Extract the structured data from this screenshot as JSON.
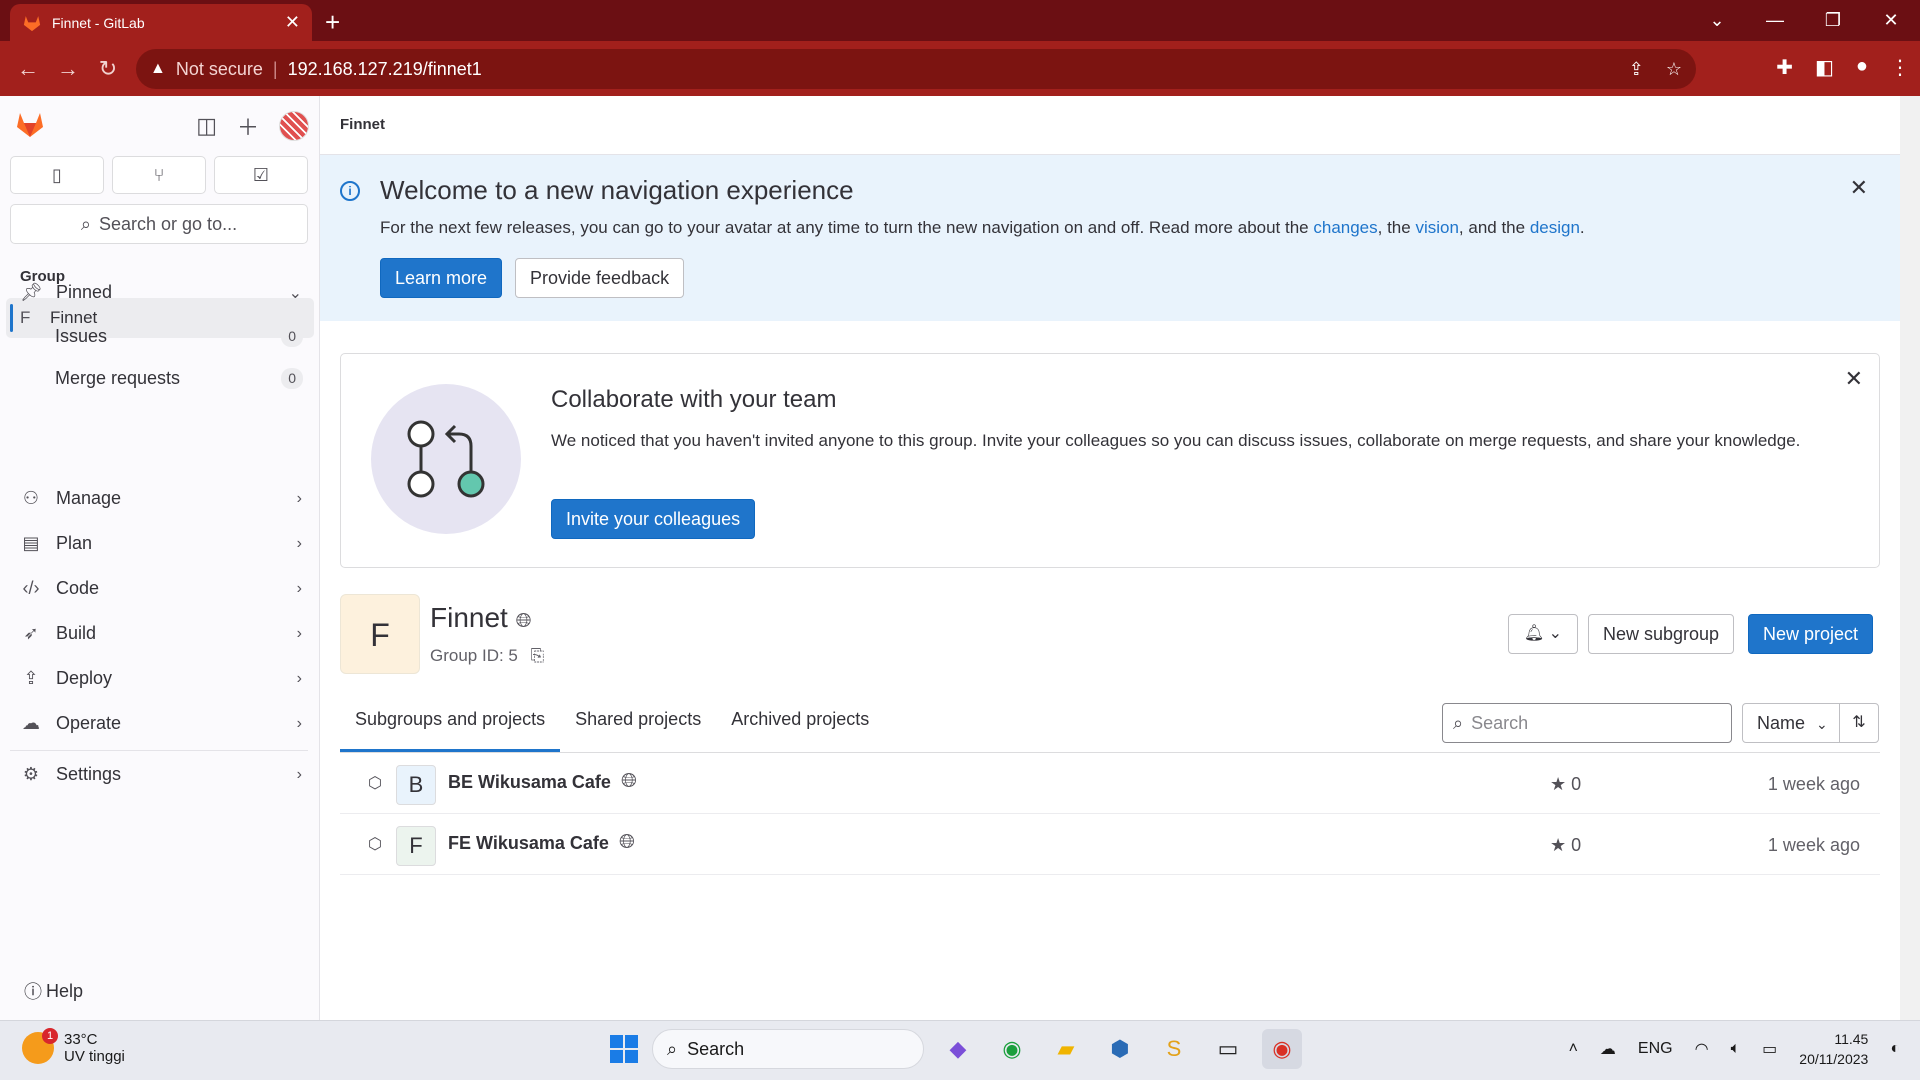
{
  "browser": {
    "tab_title": "Finnet - GitLab",
    "new_tab": "+",
    "security_label": "Not secure",
    "url": "192.168.127.219/finnet1"
  },
  "sidebar": {
    "search_placeholder": "Search or go to...",
    "context_label": "Group",
    "group": {
      "letter": "F",
      "name": "Finnet"
    },
    "pinned_label": "Pinned",
    "pinned_items": [
      {
        "label": "Issues",
        "count": "0"
      },
      {
        "label": "Merge requests",
        "count": "0"
      }
    ],
    "menu": [
      {
        "label": "Manage",
        "icon": "users-icon"
      },
      {
        "label": "Plan",
        "icon": "calendar-icon"
      },
      {
        "label": "Code",
        "icon": "code-icon"
      },
      {
        "label": "Build",
        "icon": "rocket-icon"
      },
      {
        "label": "Deploy",
        "icon": "deploy-icon"
      },
      {
        "label": "Operate",
        "icon": "cloud-icon"
      }
    ],
    "settings_label": "Settings",
    "help_label": "Help"
  },
  "breadcrumb": "Finnet",
  "welcome": {
    "title": "Welcome to a new navigation experience",
    "text_pre": "For the next few releases, you can go to your avatar at any time to turn the new navigation on and off. Read more about the ",
    "link_changes": "changes",
    "sep1": ", the ",
    "link_vision": "vision",
    "sep2": ", and the ",
    "link_design": "design",
    "end": ".",
    "learn_more": "Learn more",
    "feedback": "Provide feedback"
  },
  "collab": {
    "title": "Collaborate with your team",
    "text": "We noticed that you haven't invited anyone to this group. Invite your colleagues so you can discuss issues, collaborate on merge requests, and share your knowledge.",
    "invite": "Invite your colleagues"
  },
  "group": {
    "avatar_letter": "F",
    "name": "Finnet",
    "id_text": "Group ID: 5",
    "new_subgroup": "New subgroup",
    "new_project": "New project"
  },
  "tabs": [
    "Subgroups and projects",
    "Shared projects",
    "Archived projects"
  ],
  "list": {
    "search_placeholder": "Search",
    "sort_label": "Name"
  },
  "projects": [
    {
      "letter": "B",
      "name": "BE Wikusama Cafe",
      "stars": "0",
      "updated": "1 week ago",
      "avatar_bg": "#e9f3fc"
    },
    {
      "letter": "F",
      "name": "FE Wikusama Cafe",
      "stars": "0",
      "updated": "1 week ago",
      "avatar_bg": "#ecf4ee"
    }
  ],
  "taskbar": {
    "temp": "33°C",
    "weather": "UV tinggi",
    "badge": "1",
    "search": "Search",
    "lang": "ENG",
    "time": "11.45",
    "date": "20/11/2023"
  },
  "colors": {
    "accent": "#1f75cb",
    "browser_frame": "#a2201c"
  }
}
